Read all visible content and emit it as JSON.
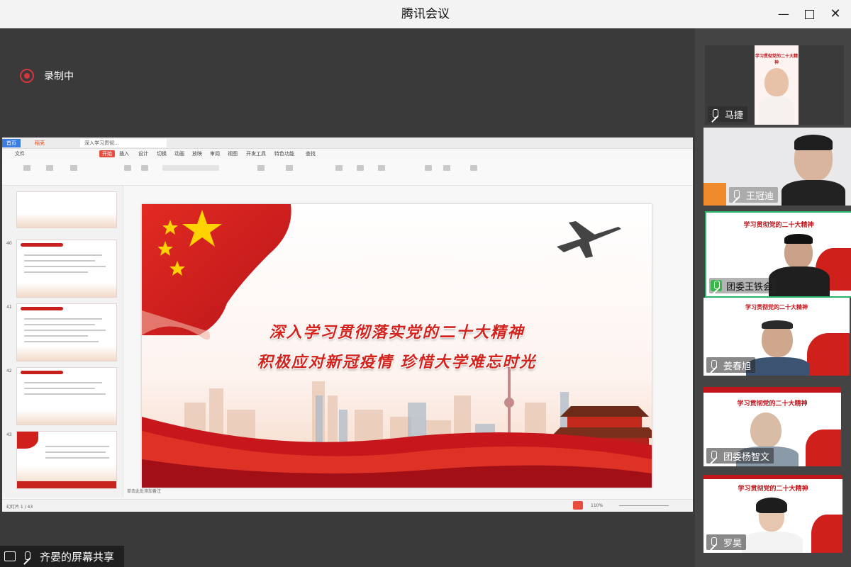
{
  "window": {
    "title": "腾讯会议"
  },
  "recording": {
    "label": "录制中"
  },
  "presentation": {
    "tabs": [
      "首页",
      "稻壳",
      "深入学习贯彻..."
    ],
    "menu": [
      "文件",
      "开始",
      "插入",
      "设计",
      "切换",
      "动画",
      "放映",
      "审阅",
      "视图",
      "开发工具",
      "特色功能",
      "查找"
    ],
    "slide_headline_1": "深入学习贯彻落实党的二十大精神",
    "slide_headline_2": "积极应对新冠疫情 珍惜大学难忘时光",
    "thumb_numbers": [
      "40",
      "41",
      "42",
      "43"
    ],
    "notes_hint": "单击此处添加备注",
    "status_left": "幻灯片 1 / 43",
    "zoom": "110%"
  },
  "participants": [
    {
      "name": "马捷"
    },
    {
      "name": "王冠迪"
    },
    {
      "name": "团委王铁会"
    },
    {
      "name": "姜春旭"
    },
    {
      "name": "团委杨智文"
    },
    {
      "name": "罗昊"
    }
  ],
  "poster": {
    "title": "学习贯彻党的二十大精神"
  },
  "sharer": {
    "label": "齐晏的屏幕共享"
  },
  "colors": {
    "accent_red": "#d3231c",
    "record_red": "#d3373b"
  }
}
